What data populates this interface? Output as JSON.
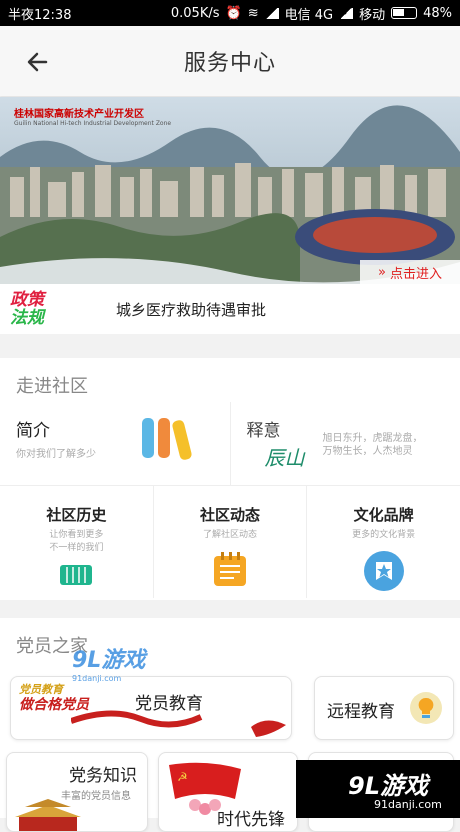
{
  "status_bar": {
    "time": "半夜12:38",
    "net_speed": "0.05K/s",
    "carrier1": "电信 4G",
    "carrier2": "移动",
    "battery": "48%"
  },
  "header": {
    "title": "服务中心"
  },
  "banner": {
    "logo_cn": "桂林国家高新技术产业开发区",
    "logo_en": "Guilin National Hi-tech Industrial Development Zone",
    "enter_label": "点击进入"
  },
  "notice": {
    "badge_line1": "政策",
    "badge_line2": "法规",
    "text": "城乡医疗救助待遇审批"
  },
  "community": {
    "title": "走进社区",
    "intro": {
      "title": "简介",
      "subtitle": "你对我们了解多少"
    },
    "meaning": {
      "title": "释意",
      "art": "辰山",
      "desc_line1": "旭日东升，虎踞龙盘，",
      "desc_line2": "万物生长，人杰地灵"
    },
    "items": [
      {
        "title": "社区历史",
        "sub1": "让你看到更多",
        "sub2": "不一样的我们"
      },
      {
        "title": "社区动态",
        "sub1": "了解社区动态",
        "sub2": ""
      },
      {
        "title": "文化品牌",
        "sub1": "更多的文化背景",
        "sub2": ""
      }
    ]
  },
  "party": {
    "title": "党员之家",
    "education": {
      "title": "党员教育",
      "art_line1": "党员教育",
      "art_line2": "做合格党员"
    },
    "remote": {
      "title": "远程教育"
    },
    "knowledge": {
      "title": "党务知识",
      "subtitle": "丰富的党员信息"
    },
    "pioneer": {
      "title": "时代先锋"
    }
  },
  "watermark": {
    "logo": "9L游戏",
    "url": "91danji.com"
  },
  "colors": {
    "accent_red": "#e02020",
    "green": "#2ab64a",
    "orange": "#f5a623",
    "blue": "#4aa3df"
  }
}
